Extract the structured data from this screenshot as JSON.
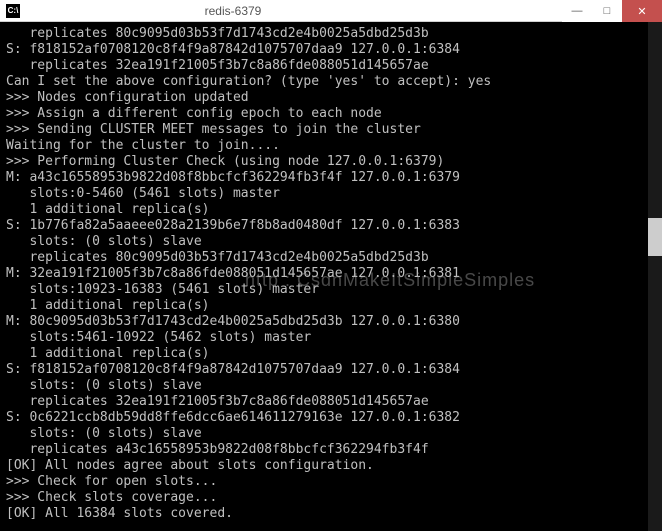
{
  "window": {
    "icon_text": "C:\\",
    "title": "redis-6379",
    "minimize": "—",
    "maximize": "□",
    "close": "✕"
  },
  "terminal": {
    "lines": [
      "   replicates 80c9095d03b53f7d1743cd2e4b0025a5dbd25d3b",
      "S: f818152af0708120c8f4f9a87842d1075707daa9 127.0.0.1:6384",
      "   replicates 32ea191f21005f3b7c8a86fde088051d145657ae",
      "Can I set the above configuration? (type 'yes' to accept): yes",
      ">>> Nodes configuration updated",
      ">>> Assign a different config epoch to each node",
      ">>> Sending CLUSTER MEET messages to join the cluster",
      "Waiting for the cluster to join....",
      ">>> Performing Cluster Check (using node 127.0.0.1:6379)",
      "M: a43c16558953b9822d08f8bbcfcf362294fb3f4f 127.0.0.1:6379",
      "   slots:0-5460 (5461 slots) master",
      "   1 additional replica(s)",
      "S: 1b776fa82a5aaeee028a2139b6e7f8b8ad0480df 127.0.0.1:6383",
      "   slots: (0 slots) slave",
      "   replicates 80c9095d03b53f7d1743cd2e4b0025a5dbd25d3b",
      "M: 32ea191f21005f3b7c8a86fde088051d145657ae 127.0.0.1:6381",
      "   slots:10923-16383 (5461 slots) master",
      "   1 additional replica(s)",
      "M: 80c9095d03b53f7d1743cd2e4b0025a5dbd25d3b 127.0.0.1:6380",
      "   slots:5461-10922 (5462 slots) master",
      "   1 additional replica(s)",
      "S: f818152af0708120c8f4f9a87842d1075707daa9 127.0.0.1:6384",
      "   slots: (0 slots) slave",
      "   replicates 32ea191f21005f3b7c8a86fde088051d145657ae",
      "S: 0c6221ccb8db59dd8ffe6dcc6ae614611279163e 127.0.0.1:6382",
      "   slots: (0 slots) slave",
      "   replicates a43c16558953b9822d08f8bbcfcf362294fb3f4f",
      "[OK] All nodes agree about slots configuration.",
      ">>> Check for open slots...",
      ">>> Check slots coverage...",
      "[OK] All 16384 slots covered."
    ]
  },
  "watermark": "http : CsdnMakeItSimpleSimples"
}
